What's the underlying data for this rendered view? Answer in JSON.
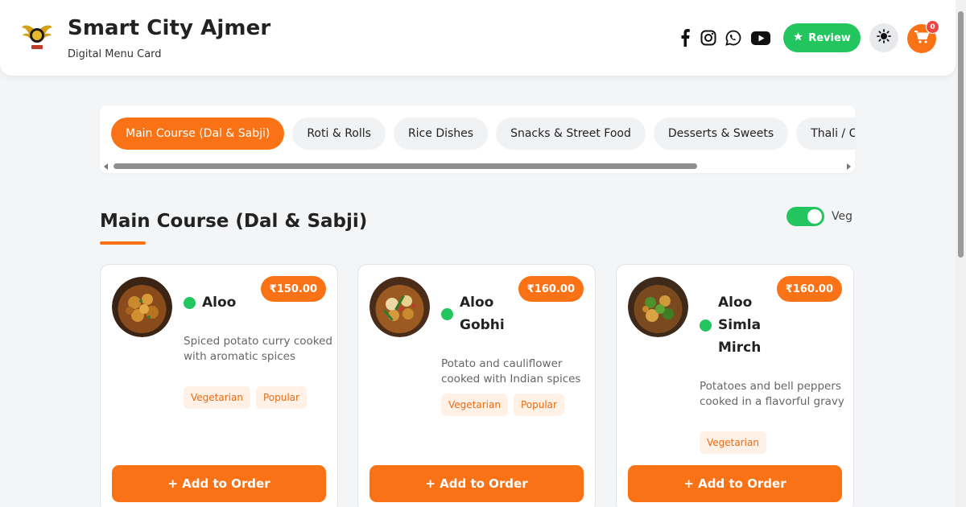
{
  "header": {
    "title": "Smart City Ajmer",
    "subtitle": "Digital Menu Card",
    "logo_icon": "winged-emblem-logo",
    "social_icons": [
      "facebook-icon",
      "instagram-icon",
      "whatsapp-icon",
      "youtube-icon"
    ],
    "review_label": "Review",
    "cart_count": "0",
    "accent_color": "#f97316",
    "success_color": "#22c55e"
  },
  "categories": [
    {
      "label": "Main Course (Dal & Sabji)",
      "active": true
    },
    {
      "label": "Roti & Rolls",
      "active": false
    },
    {
      "label": "Rice Dishes",
      "active": false
    },
    {
      "label": "Snacks & Street Food",
      "active": false
    },
    {
      "label": "Desserts & Sweets",
      "active": false
    },
    {
      "label": "Thali / Combos",
      "active": false
    }
  ],
  "section": {
    "title": "Main Course (Dal & Sabji)",
    "veg_filter_label": "Veg",
    "veg_filter_on": true
  },
  "items": [
    {
      "name_lines": [
        "Aloo"
      ],
      "price": "₹150.00",
      "description": "Spiced potato curry cooked with aromatic spices",
      "tags": [
        "Vegetarian",
        "Popular"
      ],
      "veg": true,
      "add_label": "+ Add to Order"
    },
    {
      "name_lines": [
        "Aloo",
        "Gobhi"
      ],
      "price": "₹160.00",
      "description": "Potato and cauliflower cooked with Indian spices",
      "tags": [
        "Vegetarian",
        "Popular"
      ],
      "veg": true,
      "add_label": "+ Add to Order"
    },
    {
      "name_lines": [
        "Aloo",
        "Simla",
        "Mirch"
      ],
      "price": "₹160.00",
      "description": "Potatoes and bell peppers cooked in a flavorful gravy",
      "tags": [
        "Vegetarian"
      ],
      "veg": true,
      "add_label": "+ Add to Order"
    }
  ]
}
